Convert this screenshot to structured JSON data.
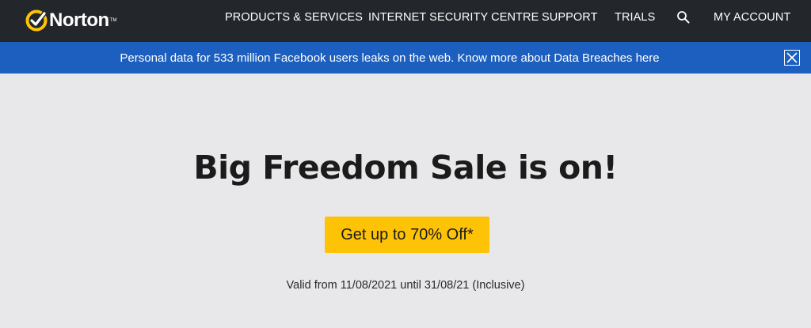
{
  "header": {
    "logo_text": "Norton",
    "logo_tm": "TM",
    "nav": {
      "products": "PRODUCTS & SERVICES",
      "security_centre": "INTERNET SECURITY CENTRE",
      "support": "SUPPORT",
      "trials": "TRIALS",
      "account": "MY ACCOUNT"
    },
    "search_icon": "search-icon"
  },
  "banner": {
    "text": "Personal data for 533 million Facebook users leaks on the web. Know more about Data Breaches here",
    "close_icon": "close-icon"
  },
  "hero": {
    "title": "Big Freedom Sale is on!",
    "cta_label": "Get up to 70% Off*",
    "validity": "Valid from 11/08/2021 until 31/08/21 (Inclusive)"
  },
  "colors": {
    "nav_bg": "#23262b",
    "banner_bg": "#1d5fbf",
    "page_bg": "#e8e7e9",
    "cta_bg": "#fec306",
    "logo_accent": "#fec306"
  }
}
